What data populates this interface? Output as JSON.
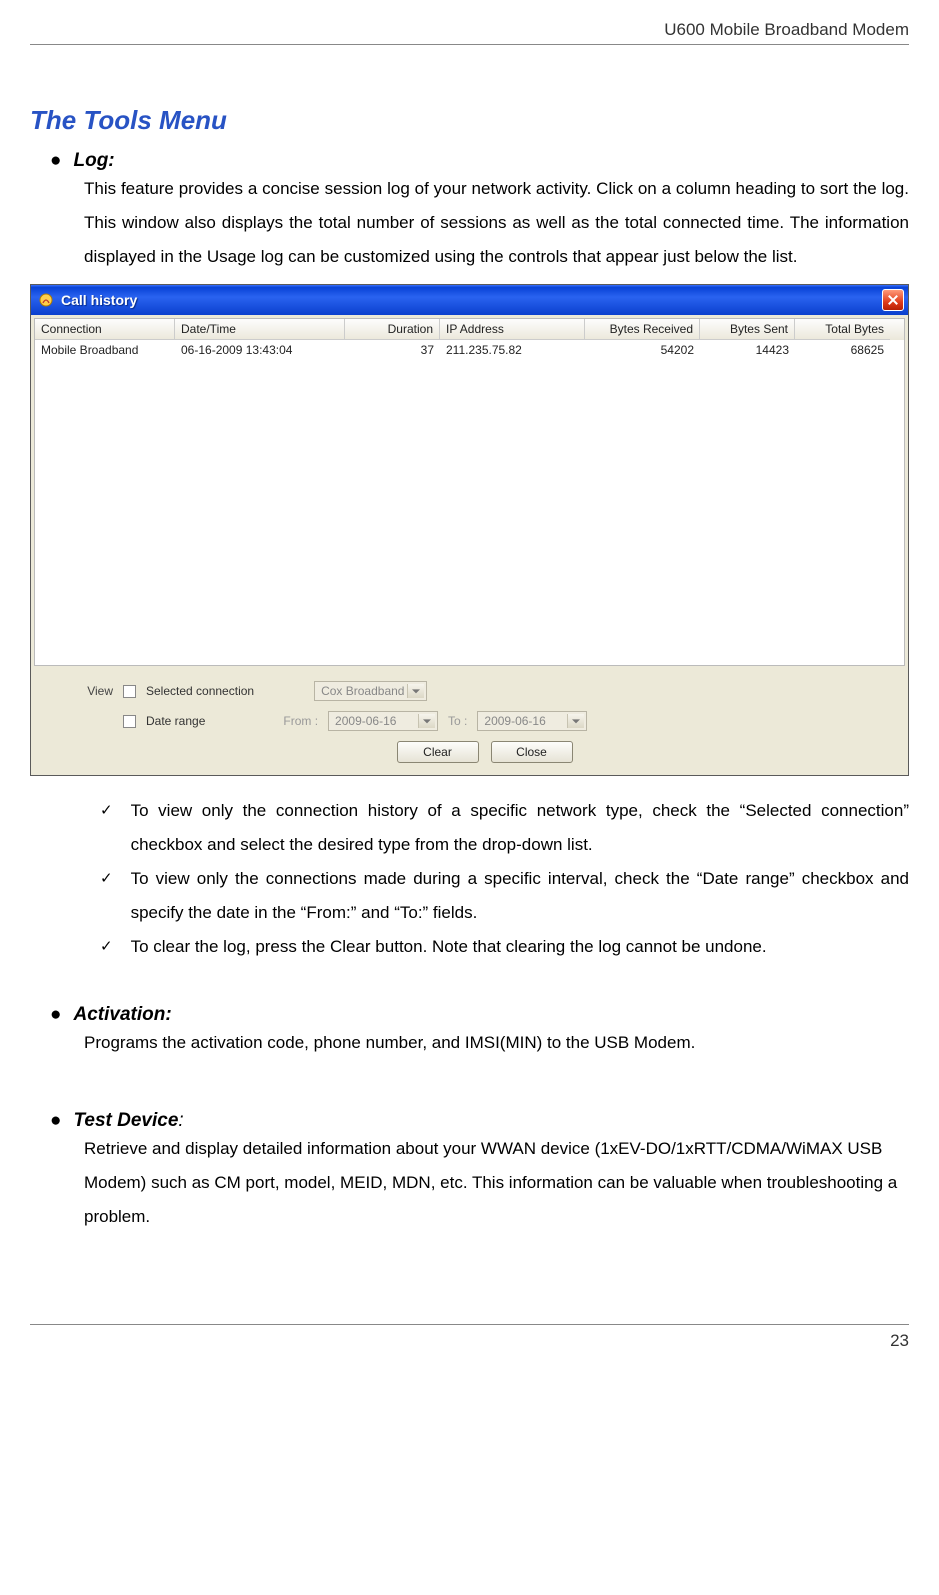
{
  "header": {
    "title": "U600 Mobile Broadband Modem"
  },
  "section_title": "The Tools Menu",
  "log": {
    "heading": "Log:",
    "body": "This feature provides a concise session log of your network activity. Click on a column heading to sort the log. This window also displays the total number of sessions as well as the total connected time. The information displayed in the Usage log can be customized using the controls that appear just below the list.",
    "checks": [
      "To view only the connection history of a specific network type, check the “Selected connection” checkbox and select the desired type from the drop-down list.",
      "To view only the connections made during a specific interval, check the “Date range” checkbox and specify the date in the “From:” and “To:” fields.",
      "To clear the log, press the Clear button. Note that clearing the log cannot be undone."
    ]
  },
  "activation": {
    "heading": "Activation:",
    "body": "Programs the activation code, phone number, and IMSI(MIN) to the USB   Modem."
  },
  "test_device": {
    "heading": "Test Device",
    "colon": ":",
    "body": "Retrieve and display detailed information about your WWAN device (1xEV-DO/1xRTT/CDMA/WiMAX USB Modem) such as CM port, model, MEID, MDN, etc. This information can be valuable when troubleshooting a problem."
  },
  "window": {
    "title": "Call history",
    "columns": {
      "connection": "Connection",
      "datetime": "Date/Time",
      "duration": "Duration",
      "ip": "IP Address",
      "recv": "Bytes Received",
      "sent": "Bytes Sent",
      "total": "Total Bytes"
    },
    "row": {
      "connection": "Mobile Broadband",
      "datetime": "06-16-2009 13:43:04",
      "duration": "37",
      "ip": "211.235.75.82",
      "recv": "54202",
      "sent": "14423",
      "total": "68625"
    },
    "filters": {
      "view_label": "View",
      "selected_connection": "Selected connection",
      "date_range": "Date range",
      "from_label": "From :",
      "to_label": "To :",
      "connection_select": "Cox Broadband",
      "from_value": "2009-06-16",
      "to_value": "2009-06-16",
      "clear": "Clear",
      "close": "Close"
    }
  },
  "page_number": "23"
}
